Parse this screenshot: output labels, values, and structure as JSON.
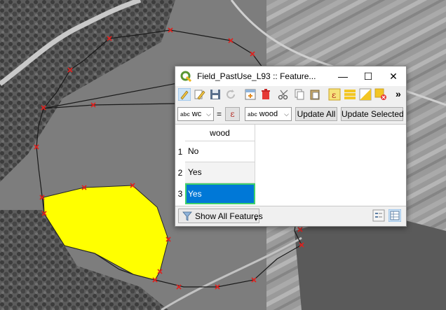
{
  "window": {
    "title": "Field_PastUse_L93 :: Feature...",
    "minimize": "—",
    "maximize": "☐",
    "close": "✕"
  },
  "toolbar": {
    "overflow": "»",
    "icons": [
      "toggle-editing-icon",
      "multi-edit-icon",
      "save-edits-icon",
      "reload-icon",
      "add-feature-icon",
      "delete-feature-icon",
      "cut-icon",
      "copy-icon",
      "paste-icon",
      "select-by-expression-icon",
      "select-all-icon",
      "invert-selection-icon",
      "deselect-all-icon"
    ]
  },
  "field_calc": {
    "field_abc": "abc",
    "field_value": "wc",
    "equals": "=",
    "expr_symbol": "ε",
    "value_abc": "abc",
    "value_value": "wood",
    "update_all": "Update All",
    "update_selected": "Update Selected"
  },
  "table": {
    "column": "wood",
    "rows": [
      {
        "num": "1",
        "value": "No"
      },
      {
        "num": "2",
        "value": "Yes"
      },
      {
        "num": "3",
        "value": "Yes"
      }
    ],
    "selected_row": 3
  },
  "status": {
    "filter_label": "Show All Features",
    "filter_dropdown": "▾"
  },
  "colors": {
    "polygon_fill": "#ffff00",
    "vertex_marker": "#e0201d",
    "selection": "#0078d7",
    "selection_border": "#3fd16a"
  }
}
